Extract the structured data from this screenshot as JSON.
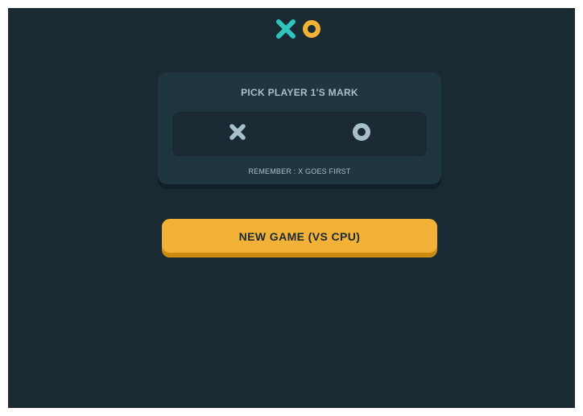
{
  "logo": {
    "x_icon": "x-icon",
    "o_icon": "o-icon",
    "x_color": "#31c3bd",
    "o_color": "#f2b137"
  },
  "pick_mark": {
    "title": "PICK PLAYER 1'S MARK",
    "options": [
      {
        "icon": "x-icon",
        "label": "X"
      },
      {
        "icon": "o-icon",
        "label": "O"
      }
    ],
    "reminder": "REMEMBER : X GOES FIRST"
  },
  "actions": {
    "new_game_cpu": "NEW GAME (VS CPU)"
  },
  "colors": {
    "background": "#1a2a33",
    "card": "#1f3641",
    "muted": "#a8bfc9",
    "accent_yellow": "#f2b137",
    "accent_teal": "#31c3bd"
  }
}
